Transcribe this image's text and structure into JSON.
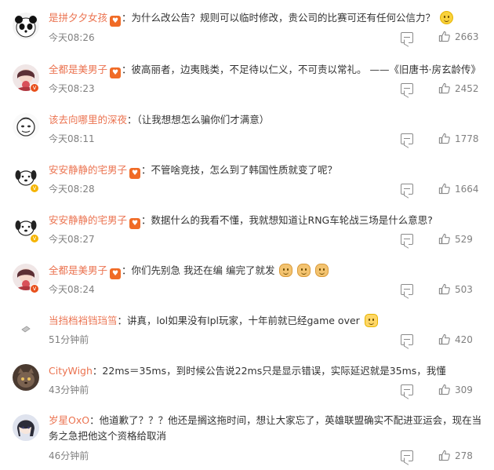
{
  "comments": [
    {
      "username": "是拼夕夕女孩",
      "text": "：为什么改公告？规则可以临时修改，贵公司的比赛可还有任何公信力？",
      "trailing_emoji": [
        "smile-emoji"
      ],
      "time": "今天08:26",
      "likes": "2663",
      "avatar": "panda-avatar",
      "badge": null
    },
    {
      "username": "全都是美男子",
      "text": "：彼高丽者，边夷贱类，不足待以仁义，不可责以常礼。 ——《旧唐书·房玄龄传》",
      "trailing_emoji": [],
      "time": "今天08:23",
      "likes": "2452",
      "avatar": "girl-avatar",
      "badge": "red"
    },
    {
      "username": "该去向哪里的深夜",
      "text": "：（让我想想怎么骗你们才满意）",
      "trailing_emoji": [],
      "time": "今天08:11",
      "likes": "1778",
      "avatar": "sketch-avatar",
      "badge": null
    },
    {
      "username": "安安静静的宅男子",
      "text": "：不管啥竞技，怎么到了韩国性质就变了呢？",
      "trailing_emoji": [],
      "time": "今天08:28",
      "likes": "1664",
      "avatar": "dog-avatar",
      "badge": "yellow"
    },
    {
      "username": "安安静静的宅男子",
      "text": "：数据什么的我看不懂，我就想知道让RNG车轮战三场是什么意思?",
      "trailing_emoji": [],
      "time": "今天08:27",
      "likes": "529",
      "avatar": "dog-avatar",
      "badge": "yellow"
    },
    {
      "username": "全都是美男子",
      "text": "：你们先别急 我还在编 编完了就发",
      "trailing_emoji": [
        "dog-emoji",
        "dog-emoji",
        "dog-emoji"
      ],
      "time": "今天08:24",
      "likes": "503",
      "avatar": "girl-avatar",
      "badge": "red"
    },
    {
      "username": "当挡档裆铛珰筜",
      "text": "：讲真，lol如果没有lpl玩家，十年前就已经game over",
      "trailing_emoji": [
        "fist-emoji"
      ],
      "time": "51分钟前",
      "likes": "420",
      "avatar": "plain-avatar",
      "badge": null
    },
    {
      "username": "CityWigh",
      "text": "：22ms＝35ms，到时候公告说22ms只是显示错误，实际延迟就是35ms，我懂",
      "trailing_emoji": [],
      "time": "43分钟前",
      "likes": "309",
      "avatar": "cat-avatar",
      "badge": null
    },
    {
      "username": "岁星OxO",
      "text": "：他道歉了？？？他还是搁这拖时间，想让大家忘了，英雄联盟确实不配进亚运会，现在当务之急把他这个资格给取消",
      "trailing_emoji": [],
      "time": "46分钟前",
      "likes": "278",
      "avatar": "anime-avatar",
      "badge": null
    }
  ],
  "colors": {
    "username": "#eb7350",
    "meta": "#808080",
    "text": "#333333"
  }
}
